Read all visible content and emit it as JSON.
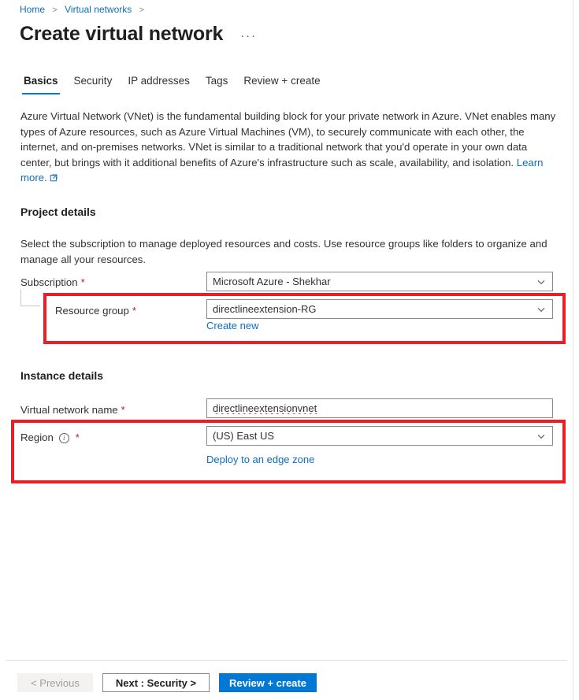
{
  "breadcrumb": {
    "items": [
      {
        "label": "Home"
      },
      {
        "label": "Virtual networks"
      }
    ],
    "separator": ">"
  },
  "header": {
    "title": "Create virtual network",
    "more_menu": "···"
  },
  "tabs": [
    {
      "label": "Basics",
      "active": true
    },
    {
      "label": "Security",
      "active": false
    },
    {
      "label": "IP addresses",
      "active": false
    },
    {
      "label": "Tags",
      "active": false
    },
    {
      "label": "Review + create",
      "active": false
    }
  ],
  "description": {
    "text": "Azure Virtual Network (VNet) is the fundamental building block for your private network in Azure. VNet enables many types of Azure resources, such as Azure Virtual Machines (VM), to securely communicate with each other, the internet, and on-premises networks. VNet is similar to a traditional network that you'd operate in your own data center, but brings with it additional benefits of Azure's infrastructure such as scale, availability, and isolation. ",
    "link_label": "Learn more."
  },
  "project_details": {
    "heading": "Project details",
    "subtext": "Select the subscription to manage deployed resources and costs. Use resource groups like folders to organize and manage all your resources.",
    "subscription": {
      "label": "Subscription",
      "required": "*",
      "value": "Microsoft Azure - Shekhar"
    },
    "resource_group": {
      "label": "Resource group",
      "required": "*",
      "value": "directlineextension-RG",
      "create_new_label": "Create new"
    }
  },
  "instance_details": {
    "heading": "Instance details",
    "vnet_name": {
      "label": "Virtual network name",
      "required": "*",
      "value": "directlineextensionvnet"
    },
    "region": {
      "label": "Region",
      "required": "*",
      "value": "(US) East US",
      "edge_zone_label": "Deploy to an edge zone"
    }
  },
  "footer": {
    "previous_label": "< Previous",
    "next_label": "Next : Security >",
    "review_label": "Review + create"
  },
  "colors": {
    "accent": "#0078d4",
    "link": "#0f6cbd",
    "annotation": "#ee1c25",
    "required": "#a4262c"
  }
}
